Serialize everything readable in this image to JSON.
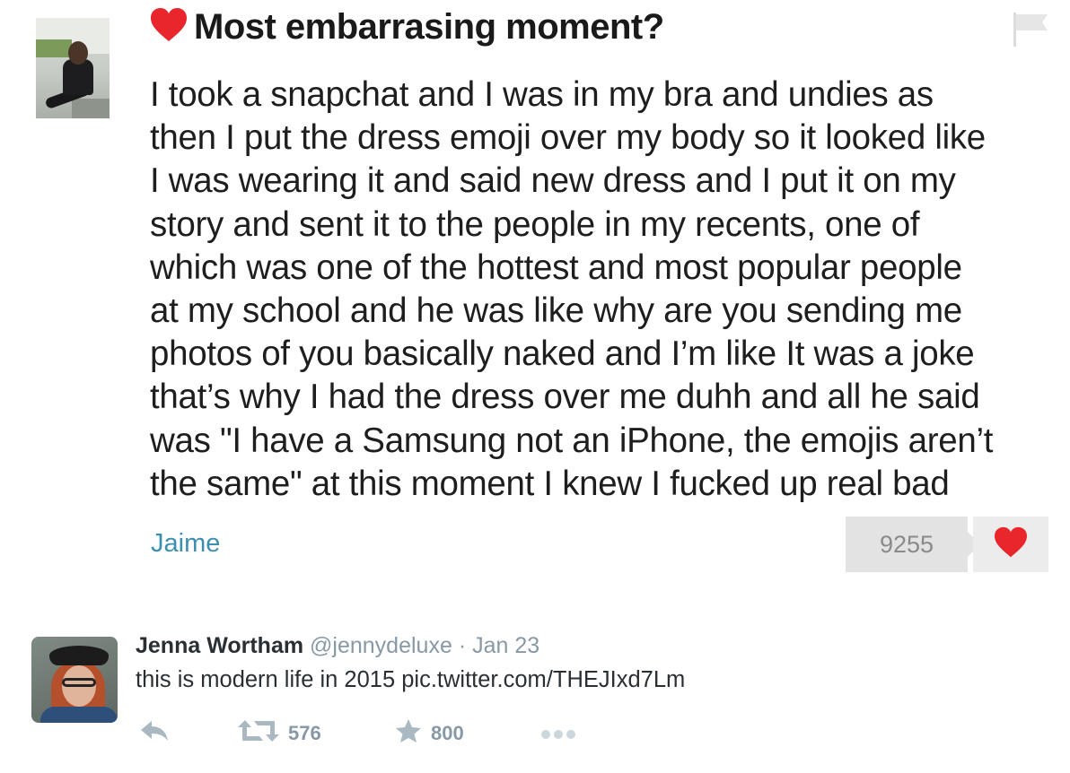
{
  "post": {
    "title": "Most embarrasing moment?",
    "lines": [
      "I took a snapchat and I was in my bra and undies as",
      "then I put the dress emoji over my body so it looked like",
      "I was wearing it and said new dress and I put it on my",
      "story and sent it to the people in my recents, one of",
      "which was one of the hottest and most popular people",
      "at my school and he was like why are you sending me",
      "photos of you basically naked and I’m like It was a joke",
      "that’s why I had the dress over me duhh and all he said",
      "was \"I have a Samsung not an iPhone, the emojis aren’t",
      "the same\" at this moment I knew I fucked up real bad"
    ],
    "author": "Jaime",
    "like_count": "9255",
    "icons": {
      "title": "heart-icon",
      "report": "flag-icon",
      "like": "heart-icon"
    },
    "colors": {
      "heart": "#e8262b",
      "author": "#3c8fb0"
    }
  },
  "tweet": {
    "name": "Jenna Wortham",
    "handle": "@jennydeluxe",
    "separator": "·",
    "date": "Jan 23",
    "text": "this is modern life in 2015 pic.twitter.com/THEJIxd7Lm",
    "retweets": "576",
    "favorites": "800",
    "icons": [
      "reply-icon",
      "retweet-icon",
      "favorite-star-icon",
      "more-icon"
    ],
    "colors": {
      "muted": "#8899a6",
      "text": "#292f33"
    }
  }
}
